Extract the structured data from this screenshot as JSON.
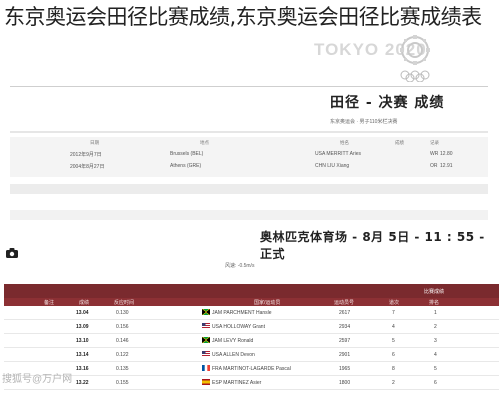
{
  "headline": "东京奥运会田径比赛成绩,东京奥运会田径比赛成绩表",
  "brand": {
    "tokyo_text": "TOKYO 2020"
  },
  "section": {
    "title": "田径 - 决赛 成绩",
    "subtitle": "东京奥运会 · 男子110米栏决赛"
  },
  "records": {
    "headers": [
      "记录",
      "成绩",
      "姓名",
      "地点",
      "日期"
    ],
    "rows": [
      {
        "type": "WR",
        "mark": "12.80",
        "name": "USA MERRITT Aries",
        "place": "Brussels (BEL)",
        "date": "2012年9月7日"
      },
      {
        "type": "OR",
        "mark": "12.91",
        "name": "CHN LIU Xiang",
        "place": "Athens (GRE)",
        "date": "2004年8月27日"
      }
    ]
  },
  "venue": {
    "text": "奥林匹克体育场 - 8月 5日 - 11 : 55 - 正式"
  },
  "wind": "风速: -0.5m/s",
  "results": {
    "title": "比赛成绩",
    "headers": [
      "排名",
      "道次",
      "运动员号",
      "国家/运动员",
      "反应时间",
      "成绩",
      "备注"
    ],
    "rows": [
      {
        "rank": "1",
        "lane": "7",
        "bib": "2617",
        "flag": "JAM",
        "athlete": "JAM PARCHMENT Hansle",
        "reaction": "0.130",
        "time": "13.04"
      },
      {
        "rank": "2",
        "lane": "4",
        "bib": "2934",
        "flag": "USA",
        "athlete": "USA HOLLOWAY Grant",
        "reaction": "0.156",
        "time": "13.09"
      },
      {
        "rank": "3",
        "lane": "5",
        "bib": "2597",
        "flag": "JAM",
        "athlete": "JAM LEVY Ronald",
        "reaction": "0.146",
        "time": "13.10"
      },
      {
        "rank": "4",
        "lane": "6",
        "bib": "2901",
        "flag": "USA",
        "athlete": "USA ALLEN Devon",
        "reaction": "0.122",
        "time": "13.14"
      },
      {
        "rank": "5",
        "lane": "8",
        "bib": "1965",
        "flag": "FRA",
        "athlete": "FRA MARTINOT-LAGARDE Pascal",
        "reaction": "0.135",
        "time": "13.16"
      },
      {
        "rank": "6",
        "lane": "2",
        "bib": "1800",
        "flag": "ESP",
        "athlete": "ESP MARTINEZ Asier",
        "reaction": "0.155",
        "time": "13.22"
      }
    ]
  },
  "watermark": "搜狐号@万户网"
}
